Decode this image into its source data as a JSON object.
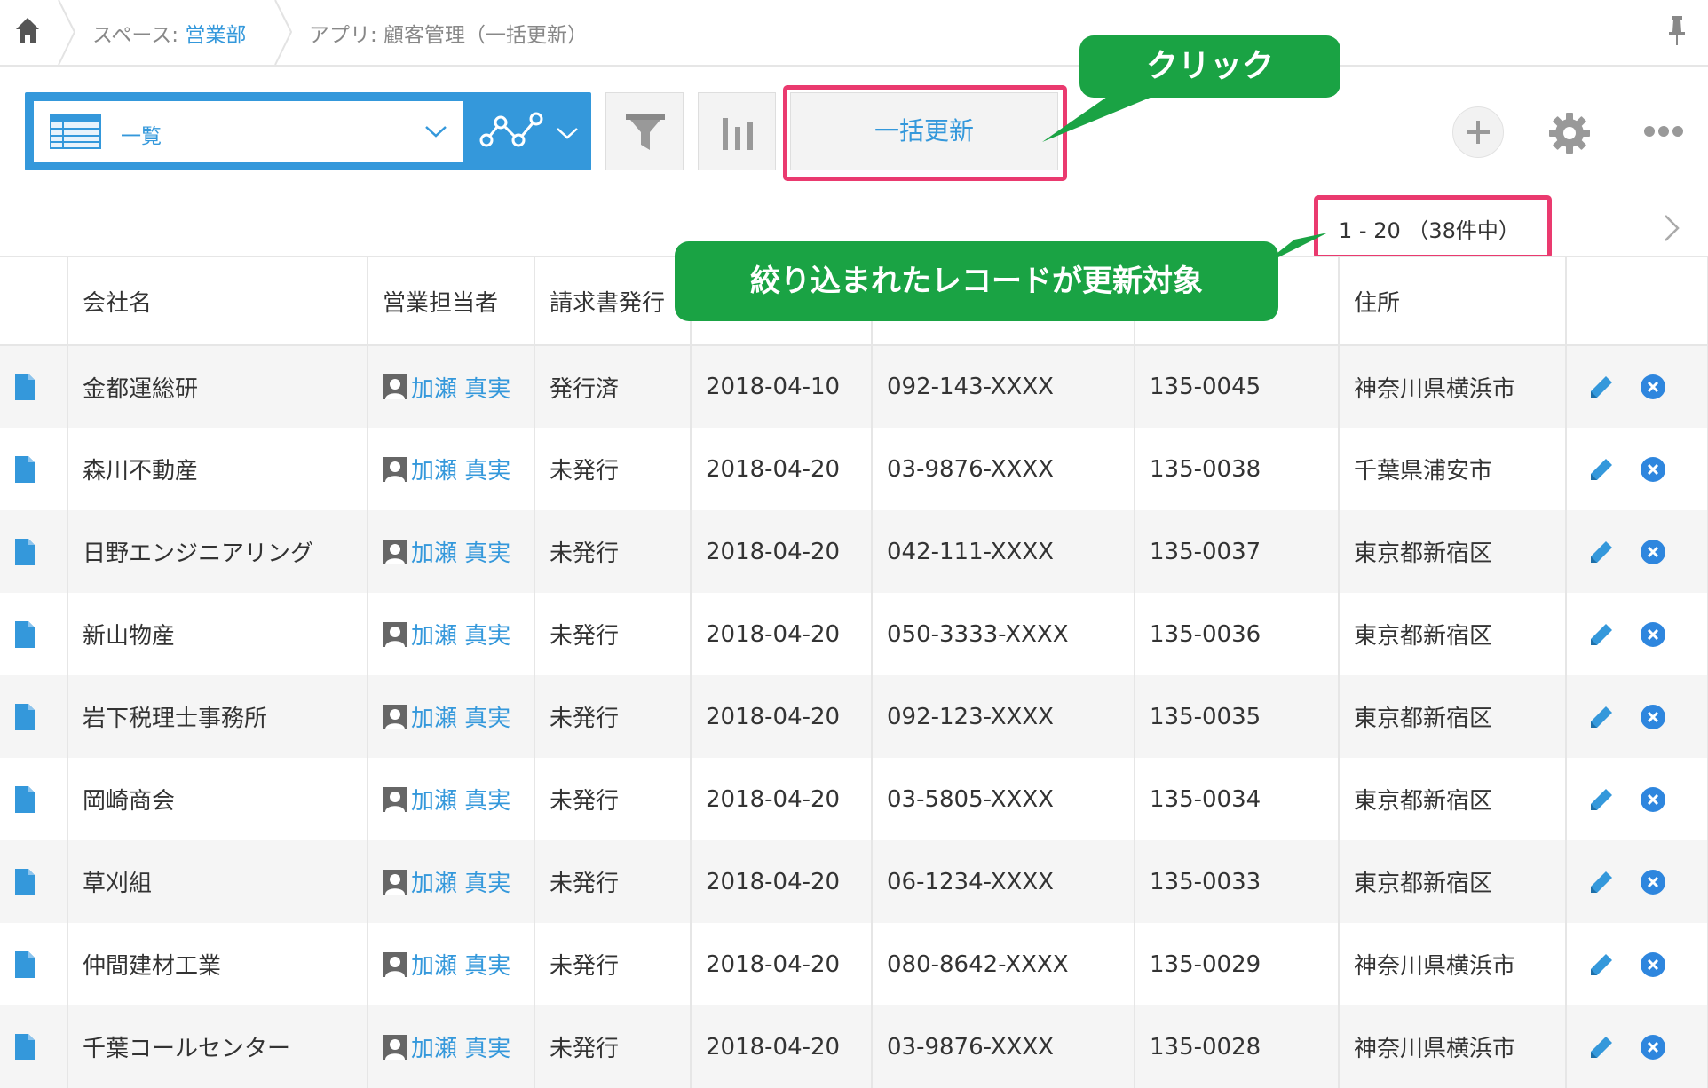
{
  "breadcrumb": {
    "space_prefix": "スペース: ",
    "space_name": "営業部",
    "app": "アプリ: 顧客管理（一括更新）"
  },
  "toolbar": {
    "view_label": "一覧",
    "bulk_update_label": "一括更新"
  },
  "callouts": {
    "click": "クリック",
    "filtered": "絞り込まれたレコードが更新対象"
  },
  "pager": {
    "range": "1 - 20 （38件中）"
  },
  "table": {
    "columns": [
      "会社名",
      "営業担当者",
      "請求書発行",
      "",
      "",
      "",
      "住所"
    ],
    "rows": [
      {
        "company": "金都運総研",
        "rep": "加瀬 真実",
        "invoice": "発行済",
        "date": "2018-04-10",
        "phone": "092-143-XXXX",
        "zip": "135-0045",
        "address": "神奈川県横浜市"
      },
      {
        "company": "森川不動産",
        "rep": "加瀬 真実",
        "invoice": "未発行",
        "date": "2018-04-20",
        "phone": "03-9876-XXXX",
        "zip": "135-0038",
        "address": "千葉県浦安市"
      },
      {
        "company": "日野エンジニアリング",
        "rep": "加瀬 真実",
        "invoice": "未発行",
        "date": "2018-04-20",
        "phone": "042-111-XXXX",
        "zip": "135-0037",
        "address": "東京都新宿区"
      },
      {
        "company": "新山物産",
        "rep": "加瀬 真実",
        "invoice": "未発行",
        "date": "2018-04-20",
        "phone": "050-3333-XXXX",
        "zip": "135-0036",
        "address": "東京都新宿区"
      },
      {
        "company": "岩下税理士事務所",
        "rep": "加瀬 真実",
        "invoice": "未発行",
        "date": "2018-04-20",
        "phone": "092-123-XXXX",
        "zip": "135-0035",
        "address": "東京都新宿区"
      },
      {
        "company": "岡崎商会",
        "rep": "加瀬 真実",
        "invoice": "未発行",
        "date": "2018-04-20",
        "phone": "03-5805-XXXX",
        "zip": "135-0034",
        "address": "東京都新宿区"
      },
      {
        "company": "草刈組",
        "rep": "加瀬 真実",
        "invoice": "未発行",
        "date": "2018-04-20",
        "phone": "06-1234-XXXX",
        "zip": "135-0033",
        "address": "東京都新宿区"
      },
      {
        "company": "仲間建材工業",
        "rep": "加瀬 真実",
        "invoice": "未発行",
        "date": "2018-04-20",
        "phone": "080-8642-XXXX",
        "zip": "135-0029",
        "address": "神奈川県横浜市"
      },
      {
        "company": "千葉コールセンター",
        "rep": "加瀬 真実",
        "invoice": "未発行",
        "date": "2018-04-20",
        "phone": "03-9876-XXXX",
        "zip": "135-0028",
        "address": "神奈川県横浜市"
      }
    ]
  },
  "colors": {
    "accent": "#3498db",
    "highlight": "#ea3a6f",
    "callout": "#1aa344",
    "delete": "#2e86de"
  }
}
